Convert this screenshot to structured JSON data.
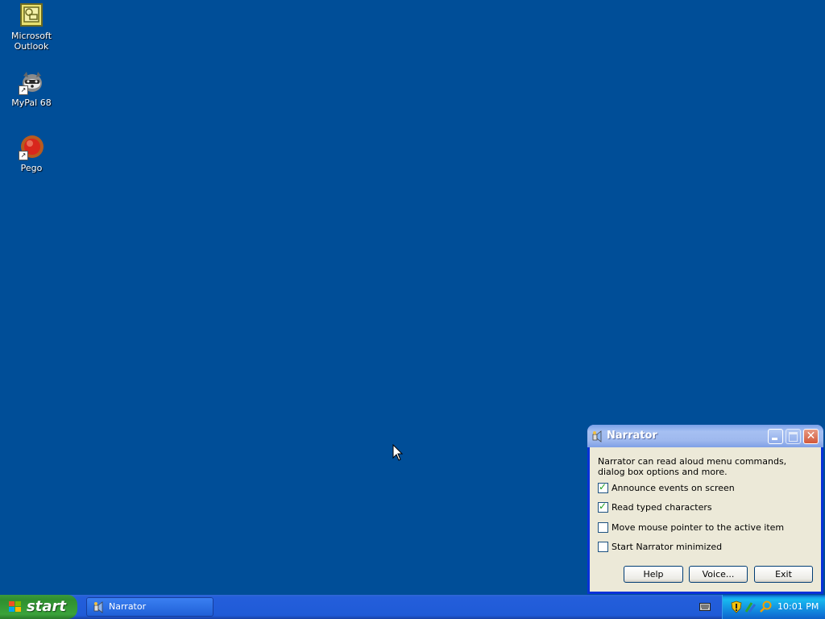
{
  "desktop": {
    "icons": [
      {
        "label_line1": "Microsoft",
        "label_line2": "Outlook",
        "icon": "outlook-icon"
      },
      {
        "label_line1": "MyPal 68",
        "icon": "mypal-icon"
      },
      {
        "label_line1": "Pego",
        "icon": "pego-icon"
      }
    ],
    "background_color": "#004e98"
  },
  "narrator": {
    "title": "Narrator",
    "intro_text": "Narrator can read aloud menu commands, dialog box options and more.",
    "options": [
      {
        "label": "Announce events on screen",
        "checked": true
      },
      {
        "label": "Read typed characters",
        "checked": true
      },
      {
        "label": "Move mouse pointer to the active item",
        "checked": false
      },
      {
        "label": "Start Narrator minimized",
        "checked": false
      }
    ],
    "buttons": {
      "help": "Help",
      "voice": "Voice...",
      "exit": "Exit"
    }
  },
  "taskbar": {
    "start_label": "start",
    "tasks": [
      {
        "label": "Narrator",
        "icon": "narrator-icon"
      }
    ],
    "tray_icons": [
      "security-shield-icon",
      "network-icon",
      "search-icon"
    ],
    "clock": "10:01 PM"
  }
}
